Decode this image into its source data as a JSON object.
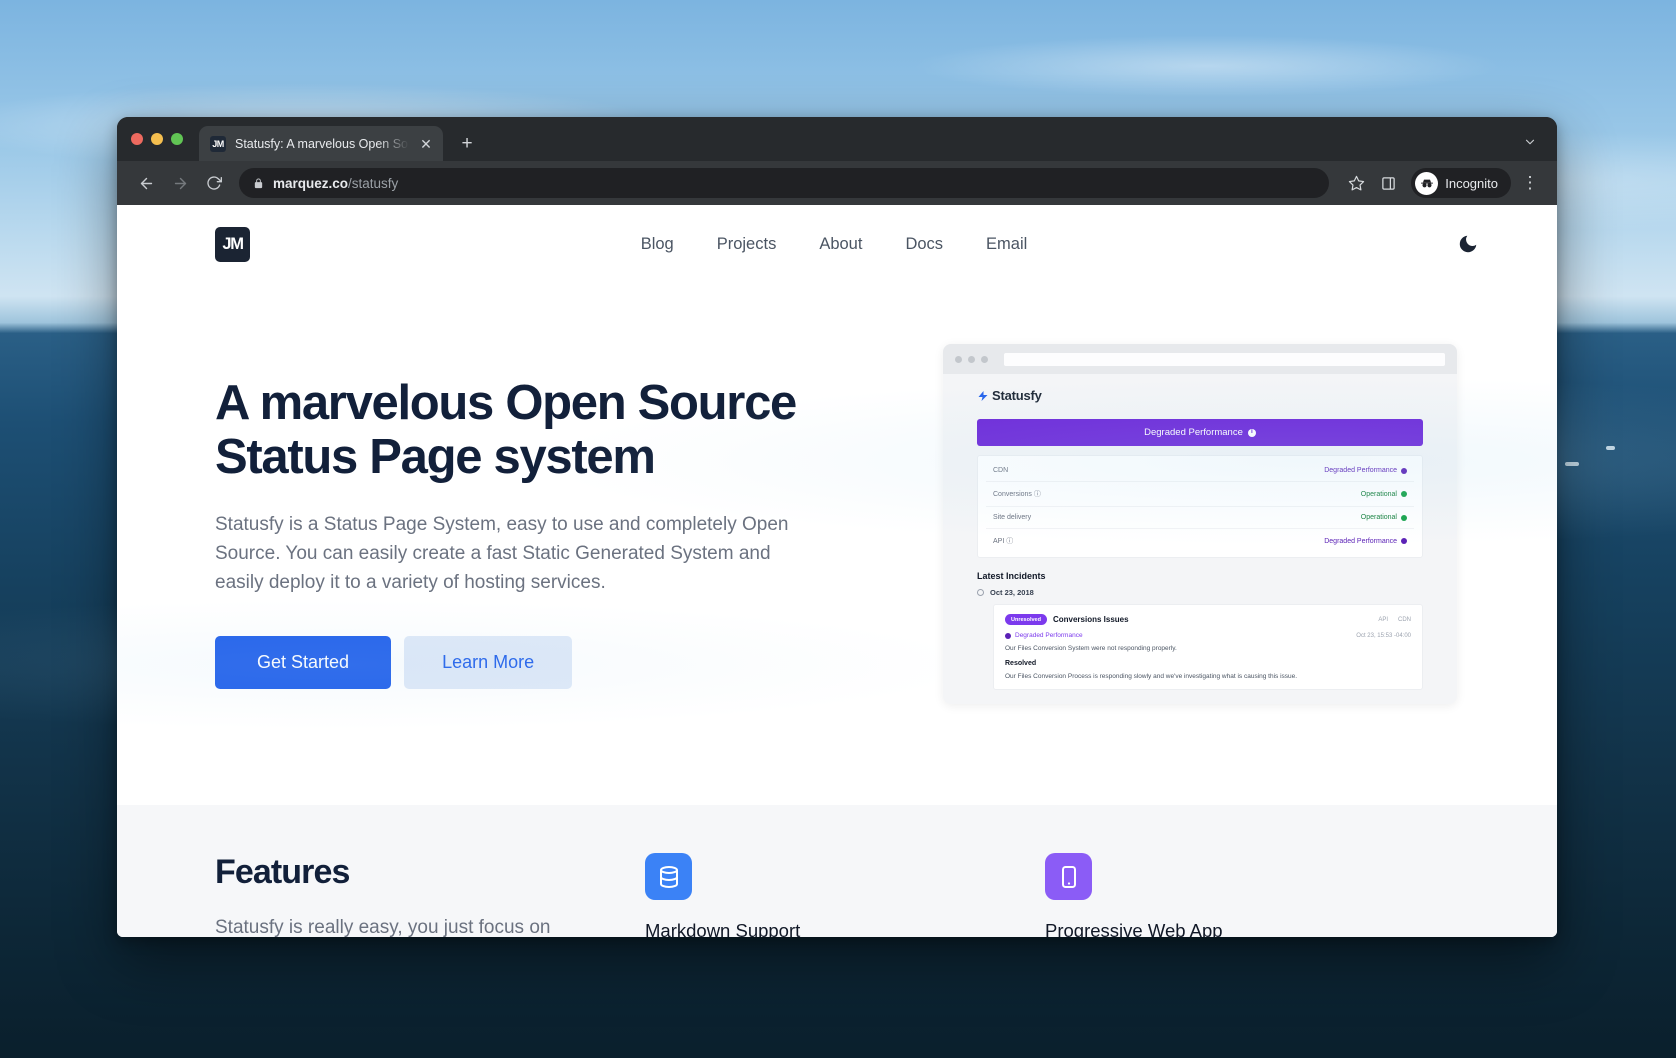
{
  "browser": {
    "tab": {
      "favicon_text": "JM",
      "title": "Statusfy: A marvelous Open So",
      "close_glyph": "✕"
    },
    "new_tab_glyph": "+",
    "toolbar": {
      "back_glyph": "←",
      "forward_glyph": "→",
      "reload_glyph": "⟳",
      "url_domain": "marquez.co",
      "url_path": "/statusfy",
      "bookmark_glyph": "☆",
      "incognito_label": "Incognito",
      "menu_glyph": "⋮"
    }
  },
  "site": {
    "logo_text": "JM",
    "nav": [
      {
        "label": "Blog"
      },
      {
        "label": "Projects"
      },
      {
        "label": "About"
      },
      {
        "label": "Docs"
      },
      {
        "label": "Email"
      }
    ]
  },
  "hero": {
    "title": "A marvelous Open Source Status Page system",
    "description": "Statusfy is a Status Page System, easy to use and completely Open Source. You can easily create a fast Static Generated System and easily deploy it to a variety of hosting services.",
    "primary_button": "Get Started",
    "secondary_button": "Learn More"
  },
  "preview": {
    "brand": "Statusfy",
    "banner": "Degraded Performance",
    "status_rows": [
      {
        "name": "CDN",
        "value": "Degraded Performance",
        "state": "degraded"
      },
      {
        "name": "Conversions ⓘ",
        "value": "Operational",
        "state": "operational"
      },
      {
        "name": "Site delivery",
        "value": "Operational",
        "state": "operational"
      },
      {
        "name": "API ⓘ",
        "value": "Degraded Performance",
        "state": "degraded"
      }
    ],
    "incidents_title": "Latest Incidents",
    "incident_date": "Oct 23, 2018",
    "incident": {
      "badge": "Unresolved",
      "title": "Conversions Issues",
      "tags": [
        "API",
        "CDN"
      ],
      "status": "Degraded Performance",
      "timestamp": "Oct 23, 15:53 -04:00",
      "body": "Our Files Conversion System were not responding properly.",
      "resolved_label": "Resolved",
      "resolved_body": "Our Files Conversion Process is responding slowly and we've investigating what is causing this issue."
    }
  },
  "features": {
    "title": "Features",
    "description": "Statusfy is really easy, you just focus on",
    "items": [
      {
        "label": "Markdown Support",
        "icon": "database-icon",
        "color": "#3b82f6"
      },
      {
        "label": "Progressive Web App",
        "icon": "mobile-icon",
        "color": "#8b5cf6"
      }
    ]
  }
}
